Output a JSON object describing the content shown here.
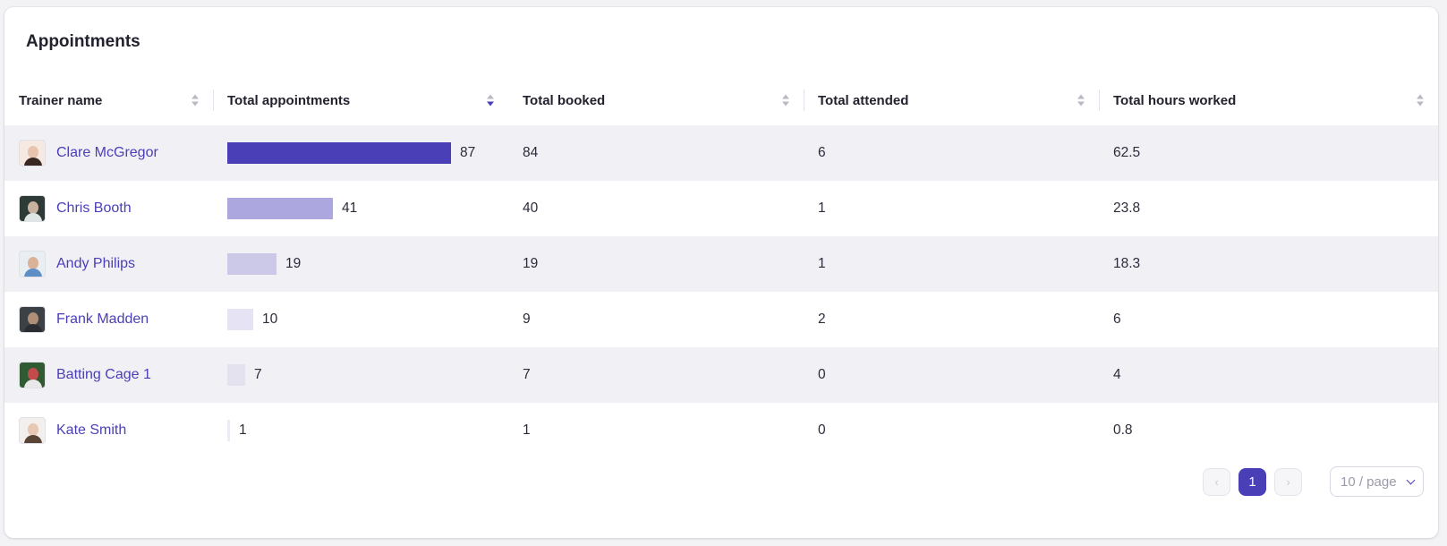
{
  "card": {
    "title": "Appointments"
  },
  "columns": [
    {
      "label": "Trainer name"
    },
    {
      "label": "Total appointments"
    },
    {
      "label": "Total booked"
    },
    {
      "label": "Total attended"
    },
    {
      "label": "Total hours worked"
    }
  ],
  "sort": {
    "column": "Total appointments",
    "direction": "descending"
  },
  "bar_colors": [
    "#4a3fb6",
    "#aca7de",
    "#cbc8e8",
    "#e5e3f4",
    "#e3e2ee",
    "#ecebf5"
  ],
  "rows": [
    {
      "name": "Clare McGregor",
      "appointments": "87",
      "booked": "84",
      "attended": "6",
      "hours": "62.5",
      "avatar": "avatar-woman-dark-hair"
    },
    {
      "name": "Chris Booth",
      "appointments": "41",
      "booked": "40",
      "attended": "1",
      "hours": "23.8",
      "avatar": "avatar-man-gym"
    },
    {
      "name": "Andy Philips",
      "appointments": "19",
      "booked": "19",
      "attended": "1",
      "hours": "18.3",
      "avatar": "avatar-man-blue-shirt"
    },
    {
      "name": "Frank Madden",
      "appointments": "10",
      "booked": "9",
      "attended": "2",
      "hours": "6",
      "avatar": "avatar-man-dark"
    },
    {
      "name": "Batting Cage 1",
      "appointments": "7",
      "booked": "7",
      "attended": "0",
      "hours": "4",
      "avatar": "avatar-batting-cage"
    },
    {
      "name": "Kate Smith",
      "appointments": "1",
      "booked": "1",
      "attended": "0",
      "hours": "0.8",
      "avatar": "avatar-woman-light"
    }
  ],
  "pagination": {
    "prev_icon": "chevron-left-icon",
    "next_icon": "chevron-right-icon",
    "current_page": "1",
    "page_size": "10 / page"
  }
}
